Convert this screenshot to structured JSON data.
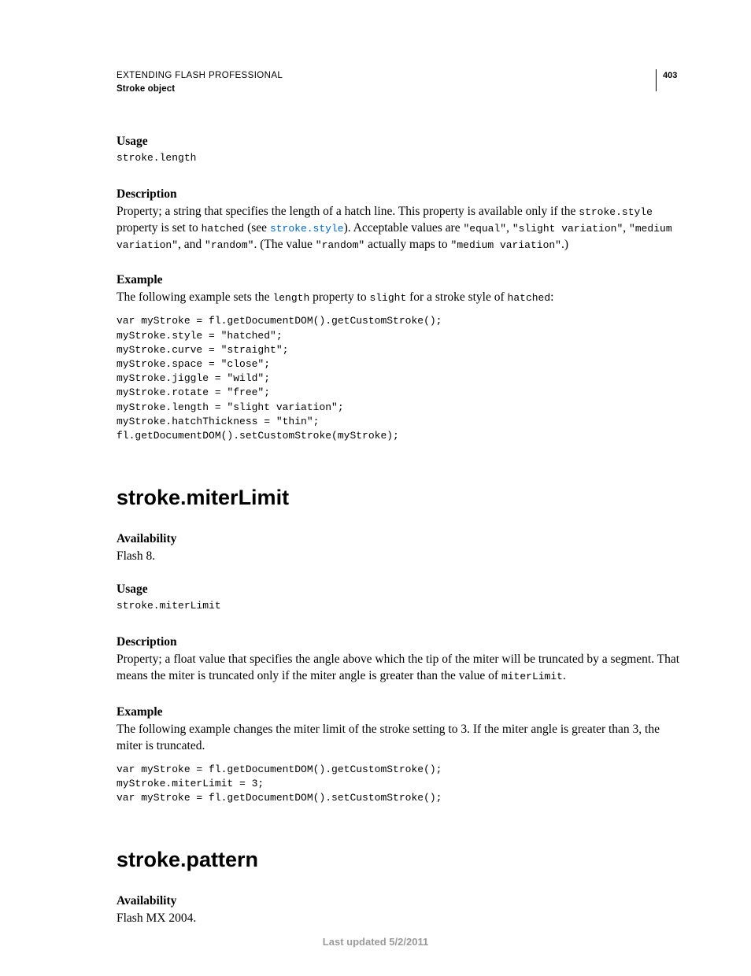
{
  "header": {
    "line1": "EXTENDING FLASH PROFESSIONAL",
    "line2": "Stroke object",
    "page_number": "403"
  },
  "section_length": {
    "usage_label": "Usage",
    "usage_code": "stroke.length",
    "description_label": "Description",
    "desc_part1": "Property; a string that specifies the length of a hatch line. This property is available only if the ",
    "desc_code1": "stroke.style",
    "desc_part2": " property is set to ",
    "desc_code2": "hatched",
    "desc_part3": " (see ",
    "desc_link": "stroke.style",
    "desc_part4": "). Acceptable values are ",
    "desc_code3": "\"equal\"",
    "desc_part5": ", ",
    "desc_code4": "\"slight variation\"",
    "desc_part6": ", ",
    "desc_code5": "\"medium variation\"",
    "desc_part7": ", and ",
    "desc_code6": "\"random\"",
    "desc_part8": ". (The value ",
    "desc_code7": "\"random\"",
    "desc_part9": " actually maps to ",
    "desc_code8": "\"medium variation\"",
    "desc_part10": ".)",
    "example_label": "Example",
    "example_intro1": "The following example sets the ",
    "example_code1": "length",
    "example_intro2": " property to ",
    "example_code2": "slight",
    "example_intro3": " for a stroke style of ",
    "example_code3": "hatched",
    "example_intro4": ":",
    "example_block": "var myStroke = fl.getDocumentDOM().getCustomStroke();\nmyStroke.style = \"hatched\";\nmyStroke.curve = \"straight\";\nmyStroke.space = \"close\";\nmyStroke.jiggle = \"wild\";\nmyStroke.rotate = \"free\";\nmyStroke.length = \"slight variation\";\nmyStroke.hatchThickness = \"thin\";\nfl.getDocumentDOM().setCustomStroke(myStroke);"
  },
  "section_miter": {
    "title": "stroke.miterLimit",
    "availability_label": "Availability",
    "availability_text": "Flash 8.",
    "usage_label": "Usage",
    "usage_code": "stroke.miterLimit",
    "description_label": "Description",
    "desc_part1": "Property; a float value that specifies the angle above which the tip of the miter will be truncated by a segment. That means the miter is truncated only if the miter angle is greater than the value of ",
    "desc_code1": "miterLimit",
    "desc_part2": ".",
    "example_label": "Example",
    "example_intro": "The following example changes the miter limit of the stroke setting to 3. If the miter angle is greater than 3, the miter is truncated.",
    "example_block": "var myStroke = fl.getDocumentDOM().getCustomStroke();\nmyStroke.miterLimit = 3;\nvar myStroke = fl.getDocumentDOM().setCustomStroke();"
  },
  "section_pattern": {
    "title": "stroke.pattern",
    "availability_label": "Availability",
    "availability_text": "Flash MX 2004."
  },
  "footer": "Last updated 5/2/2011"
}
